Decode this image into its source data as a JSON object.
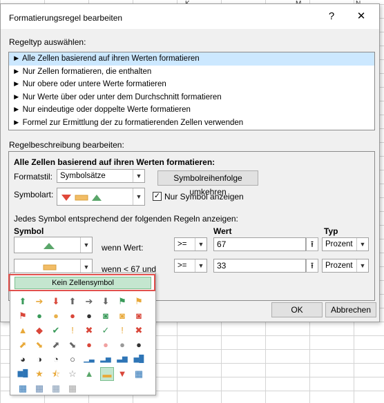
{
  "sheet": {
    "column_headers": [
      "K",
      "M",
      "N"
    ]
  },
  "dialog": {
    "title": "Formatierungsregel bearbeiten",
    "help_label": "?",
    "close_label": "✕",
    "ruletype_label": "Regeltyp auswählen:",
    "rule_types": [
      "► Alle Zellen basierend auf ihren Werten formatieren",
      "► Nur Zellen formatieren, die enthalten",
      "► Nur obere oder untere Werte formatieren",
      "► Nur Werte über oder unter dem Durchschnitt formatieren",
      "► Nur eindeutige oder doppelte Werte formatieren",
      "► Formel zur Ermittlung der zu formatierenden Zellen verwenden"
    ],
    "description_label": "Regelbeschreibung bearbeiten:",
    "description": {
      "heading": "Alle Zellen basierend auf ihren Werten formatieren:",
      "formatstil_label": "Formatstil:",
      "formatstil_value": "Symbolsätze",
      "reverse_button": "Symbolreihenfolge umkehren",
      "symbolart_label": "Symbolart:",
      "only_icon_label": "Nur Symbol anzeigen",
      "only_icon_checked": true,
      "rules_label": "Jedes Symbol entsprechend der folgenden Regeln anzeigen:",
      "col_symbol": "Symbol",
      "col_wert": "Wert",
      "col_typ": "Typ",
      "rules": [
        {
          "condition": "wenn Wert:",
          "operator": ">=",
          "value": "67",
          "type": "Prozent"
        },
        {
          "condition": "wenn < 67 und",
          "operator": ">=",
          "value": "33",
          "type": "Prozent"
        }
      ]
    },
    "ok_button": "OK",
    "cancel_button": "Abbrechen"
  },
  "palette": {
    "no_icon_label": "Kein Zellensymbol"
  }
}
